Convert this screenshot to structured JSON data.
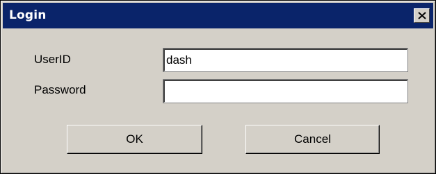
{
  "window": {
    "title": "Login",
    "close_icon": "close-x-icon"
  },
  "form": {
    "userid_label": "UserID",
    "userid_value": "dash",
    "password_label": "Password",
    "password_value": ""
  },
  "buttons": {
    "ok_label": "OK",
    "cancel_label": "Cancel"
  },
  "colors": {
    "titlebar": "#0a246a",
    "face": "#d4d0c8"
  }
}
